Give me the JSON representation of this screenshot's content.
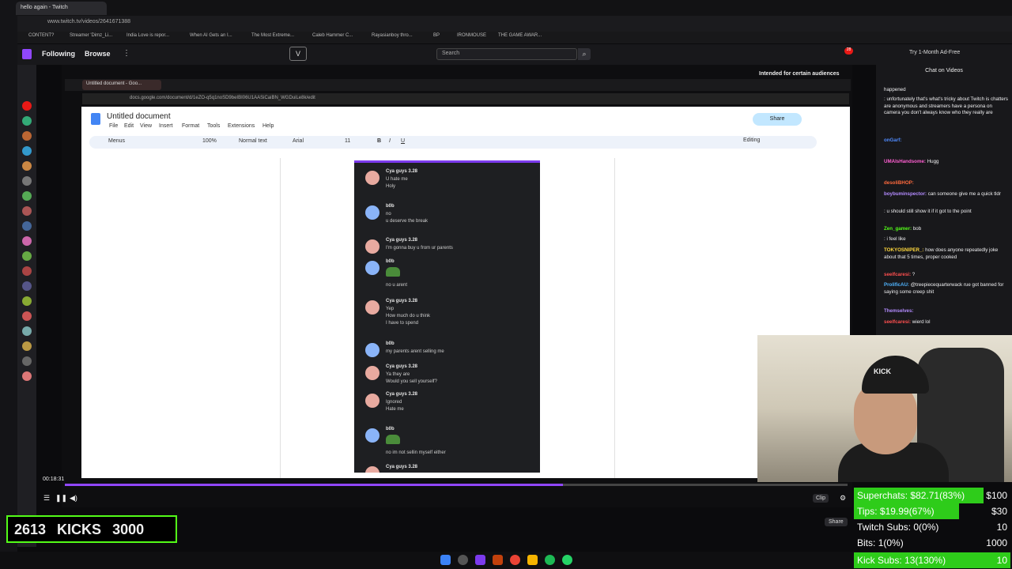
{
  "browser": {
    "tab_title": "hello again - Twitch",
    "url": "www.twitch.tv/videos/2641671388"
  },
  "bookmarks": [
    "CONTENT?",
    "Streamer 'Dimz_Li...",
    "India Love is repor...",
    "When AI Gets an I...",
    "The Most Extreme...",
    "Caleb Hammer C...",
    "Rayasianboy thro...",
    "BP",
    "IRONMOUSE",
    "THE GAME AWAR..."
  ],
  "twitch": {
    "following": "Following",
    "browse": "Browse",
    "search_placeholder": "Search",
    "ad_free": "Try 1-Month Ad-Free",
    "notif_count": "28"
  },
  "video": {
    "audience": "Intended for certain audiences",
    "time": "00:18:31",
    "clip": "Clip",
    "share": "Share"
  },
  "docs": {
    "inner_tab": "Untitled document - Goo...",
    "inner_url": "docs.google.com/document/d/1eZO-q5q1noSD9beIBI06U1AASiCaiBN_WGDuiLe8k/edit",
    "title": "Untitled document",
    "menus": [
      "File",
      "Edit",
      "View",
      "Insert",
      "Format",
      "Tools",
      "Extensions",
      "Help"
    ],
    "toolbar": {
      "menus": "Menus",
      "zoom": "100%",
      "style": "Normal text",
      "font": "Arial",
      "size": "11"
    },
    "share": "Share",
    "editing": "Editing"
  },
  "discord": [
    {
      "name": "Cya guys 3.28",
      "lines": [
        "U hate me",
        "Holy"
      ],
      "red": true
    },
    {
      "name": "b0b",
      "lines": [
        "no",
        "u deserve the break"
      ],
      "red": false
    },
    {
      "name": "Cya guys 3.28",
      "lines": [
        "I'm gonna buy u from ur parents"
      ],
      "red": true
    },
    {
      "name": "b0b",
      "lines": [
        "no u arent"
      ],
      "red": false,
      "pepe": true
    },
    {
      "name": "Cya guys 3.28",
      "lines": [
        "Yep",
        "How much do u think",
        "I have to spend"
      ],
      "red": true
    },
    {
      "name": "b0b",
      "lines": [
        "my parents arent selling me"
      ],
      "red": false
    },
    {
      "name": "Cya guys 3.28",
      "lines": [
        "Ya they are",
        "Would you sell yourself?"
      ],
      "red": true
    },
    {
      "name": "Cya guys 3.28",
      "lines": [
        "Ignored",
        "Hate me"
      ],
      "red": true
    },
    {
      "name": "b0b",
      "lines": [
        "no im not sellin myself either"
      ],
      "red": false,
      "pepe": true
    },
    {
      "name": "Cya guys 3.28",
      "lines": [],
      "red": true
    }
  ],
  "chat": {
    "header": "Chat on Videos",
    "messages": [
      {
        "user": "",
        "text": "happened",
        "color": "#efeff1"
      },
      {
        "user": "",
        "text": ": unfortunately that's what's tricky about Twitch is chatters are anonymous and streamers have a persona on camera you don't always know who they really are",
        "color": "#ff4f8b"
      },
      {
        "user": "onGarf:",
        "text": "",
        "color": "#4f8bff"
      },
      {
        "user": "",
        "text": "",
        "color": "#efeff1"
      },
      {
        "user": "UMAIsHandsome:",
        "text": "Hugg",
        "color": "#ff5fd2"
      },
      {
        "user": "",
        "text": "",
        "color": "#efeff1"
      },
      {
        "user": "desoliBHOP:",
        "text": "",
        "color": "#ff6a3d"
      },
      {
        "user": "boybuminspector:",
        "text": "can someone give me a quick tldr",
        "color": "#b38bff"
      },
      {
        "user": "",
        "text": ": u should still show it if it got to the point",
        "color": "#4f8bff"
      },
      {
        "user": "Zen_gamer:",
        "text": "bob",
        "color": "#53fc18"
      },
      {
        "user": "",
        "text": ": i feel like",
        "color": "#4f8bff"
      },
      {
        "user": "TOKYOSNIPER_:",
        "text": "how does anyone repeatedly joke about that 5 times, proper cooked",
        "color": "#ffd83d"
      },
      {
        "user": "seelfcaresi:",
        "text": "?",
        "color": "#ff4f4f"
      },
      {
        "user": "ProlificAU:",
        "text": "@treepiecequarterwack rue got banned for saying some creep shit",
        "color": "#4fb4ff"
      },
      {
        "user": "Themselves:",
        "text": "",
        "color": "#b38bff"
      },
      {
        "user": "seelfcaresi:",
        "text": "wierd lol",
        "color": "#ff4f4f"
      }
    ]
  },
  "kicks": {
    "current": "2613",
    "label": "KICKS",
    "goal": "3000"
  },
  "stats": [
    {
      "label": "Superchats:",
      "value": "$82.71(83%)",
      "goal": "$100",
      "fill": 0.83,
      "color": "#2ecc1a"
    },
    {
      "label": "Tips:",
      "value": "$19.99(67%)",
      "goal": "$30",
      "fill": 0.67,
      "color": "#2ecc1a"
    },
    {
      "label": "Twitch Subs:",
      "value": "0(0%)",
      "goal": "10",
      "fill": 0,
      "color": "#2ecc1a"
    },
    {
      "label": "Bits:",
      "value": "1(0%)",
      "goal": "1000",
      "fill": 0,
      "color": "#2ecc1a"
    },
    {
      "label": "Kick Subs:",
      "value": "13(130%)",
      "goal": "10",
      "fill": 1,
      "color": "#2ecc1a"
    }
  ],
  "accent": "#9147ff"
}
